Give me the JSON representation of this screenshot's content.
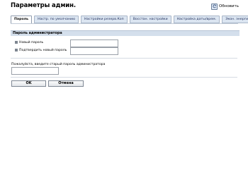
{
  "header": {
    "title": "Параметры админ.",
    "refresh_label": "Обновить"
  },
  "tabs": [
    {
      "label": "Пароль",
      "active": true
    },
    {
      "label": "Настр. по умолчанию",
      "active": false
    },
    {
      "label": "Настройки резерв.Коп",
      "active": false
    },
    {
      "label": "Восстан. настройки",
      "active": false
    },
    {
      "label": "Настройка даты/врем.",
      "active": false
    },
    {
      "label": "Экон. энергии",
      "active": false
    }
  ],
  "admin_password": {
    "section_title": "Пароль администратора",
    "new_password_label": "Новый пароль",
    "new_password_value": "",
    "confirm_password_label": "Подтвердить новый пароль",
    "confirm_password_value": ""
  },
  "old_password": {
    "prompt": "Пожалуйста, введите старый пароль администратора",
    "value": ""
  },
  "buttons": {
    "ok_label": "OK",
    "cancel_label": "Отмена"
  },
  "colors": {
    "tab_background": "#dbe5f1",
    "section_header_background": "#d4dfec",
    "bullet": "#7d8590"
  }
}
